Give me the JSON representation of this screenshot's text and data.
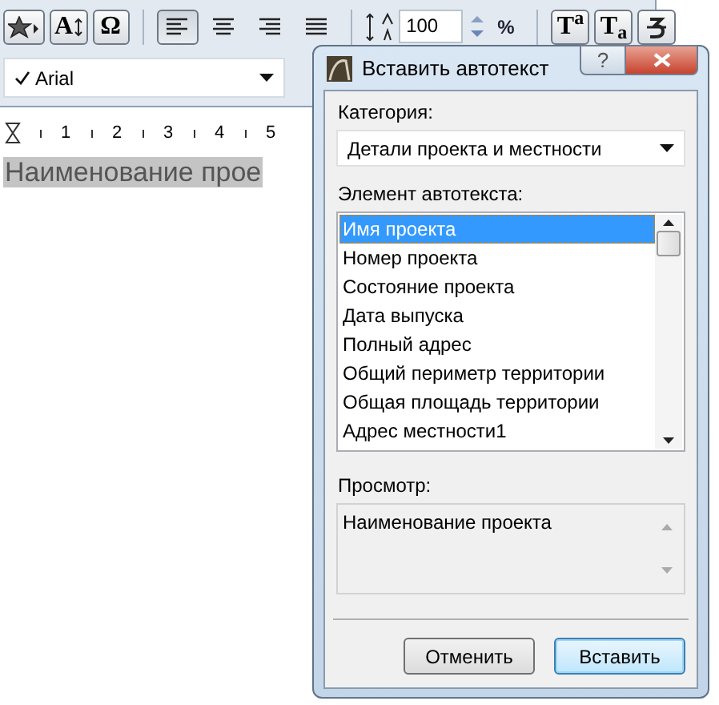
{
  "toolbar": {
    "insert_buttons": [
      {
        "kind": "symbol"
      },
      {
        "kind": "size",
        "glyph": "A"
      },
      {
        "kind": "special",
        "glyph": "Ω"
      }
    ],
    "alignment": [
      {
        "kind": "left",
        "selected": true
      },
      {
        "kind": "center",
        "selected": false
      },
      {
        "kind": "right",
        "selected": false
      },
      {
        "kind": "justify",
        "selected": false
      }
    ],
    "line_spacing": {
      "value": "100",
      "unit": "%"
    },
    "script_buttons": [
      {
        "kind": "superscript",
        "glyph": "T$^{a}$"
      },
      {
        "kind": "subscript",
        "glyph": "T$_{a}$"
      },
      {
        "kind": "strike"
      }
    ],
    "font": {
      "value": "Arial",
      "checked": true
    }
  },
  "ruler": {
    "numbers": [
      "1",
      "2",
      "3",
      "4",
      "5"
    ]
  },
  "document": {
    "text": "Наименование прое",
    "selected": true
  },
  "dialog": {
    "title": "Вставить автотекст",
    "caption_buttons": [
      {
        "kind": "help",
        "glyph": "?"
      },
      {
        "kind": "close"
      }
    ],
    "category_label": "Категория:",
    "category": "Детали проекта и местности",
    "element_label": "Элемент автотекста:",
    "elements": [
      {
        "label": "Имя проекта",
        "selected": true
      },
      {
        "label": "Номер проекта",
        "selected": false
      },
      {
        "label": "Состояние проекта",
        "selected": false
      },
      {
        "label": "Дата выпуска",
        "selected": false
      },
      {
        "label": "Полный адрес",
        "selected": false
      },
      {
        "label": "Общий периметр территории",
        "selected": false
      },
      {
        "label": "Общая площадь территории",
        "selected": false
      },
      {
        "label": "Адрес местности1",
        "selected": false
      }
    ],
    "preview_label": "Просмотр:",
    "preview": "Наименование проекта",
    "buttons": [
      {
        "label": "Отменить",
        "default": false
      },
      {
        "label": "Вставить",
        "default": true
      }
    ]
  }
}
